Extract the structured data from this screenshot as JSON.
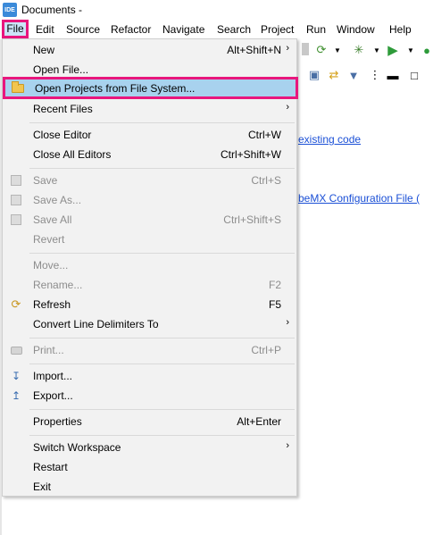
{
  "window": {
    "app_icon_text": "IDE",
    "title": "Documents -"
  },
  "menubar": {
    "items": [
      "File",
      "Edit",
      "Source",
      "Refactor",
      "Navigate",
      "Search",
      "Project",
      "Run",
      "Window",
      "Help"
    ]
  },
  "background": {
    "link1": "existing code",
    "link2": "beMX Configuration File ("
  },
  "file_menu": {
    "new": {
      "label": "New",
      "accel": "Alt+Shift+N"
    },
    "open_file": {
      "label": "Open File..."
    },
    "open_projects": {
      "label": "Open Projects from File System..."
    },
    "recent_files": {
      "label": "Recent Files"
    },
    "close_editor": {
      "label": "Close Editor",
      "accel": "Ctrl+W"
    },
    "close_all_editors": {
      "label": "Close All Editors",
      "accel": "Ctrl+Shift+W"
    },
    "save": {
      "label": "Save",
      "accel": "Ctrl+S"
    },
    "save_as": {
      "label": "Save As..."
    },
    "save_all": {
      "label": "Save All",
      "accel": "Ctrl+Shift+S"
    },
    "revert": {
      "label": "Revert"
    },
    "move": {
      "label": "Move..."
    },
    "rename": {
      "label": "Rename...",
      "accel": "F2"
    },
    "refresh": {
      "label": "Refresh",
      "accel": "F5"
    },
    "convert": {
      "label": "Convert Line Delimiters To"
    },
    "print": {
      "label": "Print...",
      "accel": "Ctrl+P"
    },
    "import": {
      "label": "Import..."
    },
    "export": {
      "label": "Export..."
    },
    "properties": {
      "label": "Properties",
      "accel": "Alt+Enter"
    },
    "switch_workspace": {
      "label": "Switch Workspace"
    },
    "restart": {
      "label": "Restart"
    },
    "exit": {
      "label": "Exit"
    }
  },
  "colors": {
    "highlight_border": "#e8177d",
    "highlight_fill": "#a8d2ee",
    "link": "#1a4fd6"
  }
}
